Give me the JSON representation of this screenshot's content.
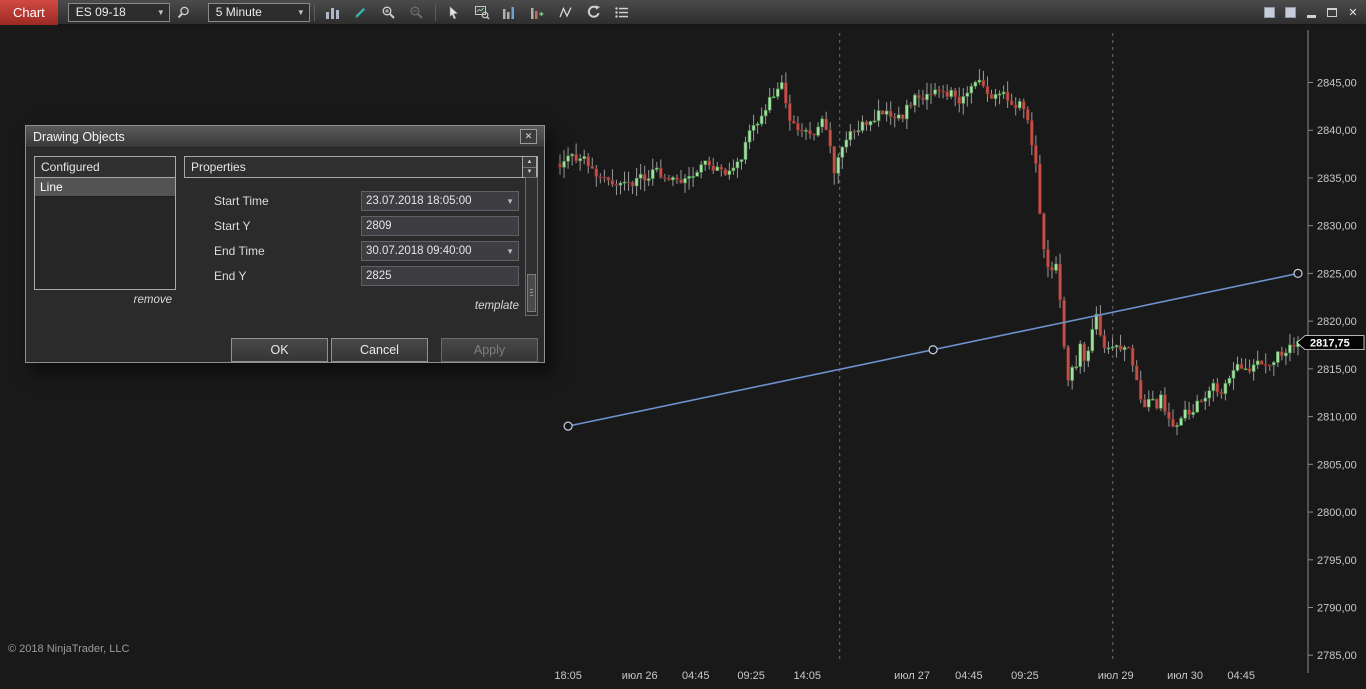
{
  "window": {
    "tab_label": "Chart",
    "copyright": "© 2018 NinjaTrader, LLC"
  },
  "toolbar": {
    "instrument": "ES 09-18",
    "interval": "5 Minute",
    "icons": [
      "instrument-search",
      "chart-style",
      "drawing-tools",
      "zoom-in",
      "zoom-out",
      "cursor",
      "data-box",
      "bar-spacing",
      "bar-type",
      "regression",
      "reload",
      "display-properties"
    ]
  },
  "dialog": {
    "title": "Drawing Objects",
    "configured_header": "Configured",
    "items": [
      "Line"
    ],
    "remove_label": "remove",
    "properties_header": "Properties",
    "fields": [
      {
        "label": "Start Time",
        "value": "23.07.2018 18:05:00",
        "type": "dropdown"
      },
      {
        "label": "Start Y",
        "value": "2809",
        "type": "text"
      },
      {
        "label": "End Time",
        "value": "30.07.2018 09:40:00",
        "type": "dropdown"
      },
      {
        "label": "End Y",
        "value": "2825",
        "type": "text"
      }
    ],
    "template_label": "template",
    "buttons": {
      "ok": "OK",
      "cancel": "Cancel",
      "apply": "Apply"
    }
  },
  "chart_data": {
    "type": "candlestick",
    "instrument": "ES 09-18",
    "interval": "5 Minute",
    "last_price": 2817.75,
    "last_price_label": "2817,75",
    "y_axis": {
      "ticks": [
        2785,
        2790,
        2795,
        2800,
        2805,
        2810,
        2815,
        2820,
        2825,
        2830,
        2835,
        2840,
        2845
      ],
      "tick_labels": [
        "2785,00",
        "2790,00",
        "2795,00",
        "2800,00",
        "2805,00",
        "2810,00",
        "2815,00",
        "2820,00",
        "2825,00",
        "2830,00",
        "2835,00",
        "2840,00",
        "2845,00"
      ],
      "min": 2784.5,
      "max": 2850.5
    },
    "x_ticks": [
      {
        "t": 0.011,
        "label": "18:05"
      },
      {
        "t": 0.108,
        "label": "июл 26"
      },
      {
        "t": 0.184,
        "label": "04:45"
      },
      {
        "t": 0.259,
        "label": "09:25"
      },
      {
        "t": 0.335,
        "label": "14:05"
      },
      {
        "t": 0.477,
        "label": "июл 27"
      },
      {
        "t": 0.554,
        "label": "04:45"
      },
      {
        "t": 0.63,
        "label": "09:25"
      },
      {
        "t": 0.753,
        "label": "июл 29"
      },
      {
        "t": 0.847,
        "label": "июл 30"
      },
      {
        "t": 0.923,
        "label": "04:45"
      }
    ],
    "session_breaks": [
      0.379,
      0.749
    ],
    "trend_line": {
      "start": {
        "t": 0.011,
        "price": 2809,
        "time": "23.07.2018 18:05:00"
      },
      "end": {
        "t": 1.0,
        "price": 2825,
        "time": "30.07.2018 09:40:00"
      },
      "color": "#6d92cf"
    },
    "num_bars": 184,
    "price_path": [
      [
        0.0,
        2836.5
      ],
      [
        0.03,
        2837.5
      ],
      [
        0.055,
        2835.0
      ],
      [
        0.08,
        2834.2
      ],
      [
        0.105,
        2834.8
      ],
      [
        0.13,
        2835.8
      ],
      [
        0.15,
        2834.6
      ],
      [
        0.175,
        2835.2
      ],
      [
        0.2,
        2836.6
      ],
      [
        0.22,
        2835.6
      ],
      [
        0.24,
        2836.2
      ],
      [
        0.258,
        2839.8
      ],
      [
        0.272,
        2841.2
      ],
      [
        0.287,
        2843.6
      ],
      [
        0.3,
        2844.8
      ],
      [
        0.31,
        2841.5
      ],
      [
        0.322,
        2840.2
      ],
      [
        0.34,
        2839.2
      ],
      [
        0.355,
        2841.6
      ],
      [
        0.366,
        2838.2
      ],
      [
        0.372,
        2834.8
      ],
      [
        0.382,
        2838.6
      ],
      [
        0.4,
        2840.2
      ],
      [
        0.42,
        2840.8
      ],
      [
        0.44,
        2842.2
      ],
      [
        0.46,
        2841.2
      ],
      [
        0.48,
        2843.2
      ],
      [
        0.5,
        2843.6
      ],
      [
        0.52,
        2844.2
      ],
      [
        0.54,
        2843.2
      ],
      [
        0.556,
        2844.6
      ],
      [
        0.566,
        2845.6
      ],
      [
        0.58,
        2843.2
      ],
      [
        0.6,
        2843.8
      ],
      [
        0.615,
        2842.2
      ],
      [
        0.625,
        2842.8
      ],
      [
        0.635,
        2840.8
      ],
      [
        0.645,
        2836.2
      ],
      [
        0.652,
        2830.2
      ],
      [
        0.658,
        2826.2
      ],
      [
        0.665,
        2824.2
      ],
      [
        0.67,
        2827.6
      ],
      [
        0.676,
        2823.2
      ],
      [
        0.682,
        2818.2
      ],
      [
        0.687,
        2812.8
      ],
      [
        0.692,
        2816.2
      ],
      [
        0.698,
        2814.2
      ],
      [
        0.705,
        2817.6
      ],
      [
        0.712,
        2815.2
      ],
      [
        0.718,
        2818.6
      ],
      [
        0.727,
        2820.6
      ],
      [
        0.733,
        2818.2
      ],
      [
        0.74,
        2816.8
      ],
      [
        0.75,
        2817.6
      ],
      [
        0.76,
        2816.6
      ],
      [
        0.77,
        2817.2
      ],
      [
        0.778,
        2814.6
      ],
      [
        0.785,
        2812.2
      ],
      [
        0.792,
        2810.6
      ],
      [
        0.8,
        2812.2
      ],
      [
        0.808,
        2811.2
      ],
      [
        0.815,
        2812.6
      ],
      [
        0.822,
        2810.2
      ],
      [
        0.83,
        2808.6
      ],
      [
        0.838,
        2809.6
      ],
      [
        0.845,
        2810.6
      ],
      [
        0.855,
        2810.2
      ],
      [
        0.865,
        2811.6
      ],
      [
        0.875,
        2812.2
      ],
      [
        0.885,
        2813.6
      ],
      [
        0.895,
        2812.6
      ],
      [
        0.905,
        2814.2
      ],
      [
        0.915,
        2815.6
      ],
      [
        0.925,
        2814.6
      ],
      [
        0.935,
        2815.2
      ],
      [
        0.945,
        2816.2
      ],
      [
        0.955,
        2814.8
      ],
      [
        0.965,
        2815.8
      ],
      [
        0.975,
        2816.6
      ],
      [
        0.988,
        2817.2
      ],
      [
        1.0,
        2817.75
      ]
    ],
    "colors": {
      "up": "#a8dca8",
      "up_border": "#3f8f3f",
      "down": "#c0504a",
      "down_border": "#7d2a26",
      "wick": "#9a9a9a",
      "trend": "#6d92cf",
      "axis_text": "#c8c8c8",
      "axis_line": "#8a8a8a",
      "session_break": "#6e6e6e",
      "badge_bg": "#050505",
      "badge_text": "#ffffff"
    }
  }
}
